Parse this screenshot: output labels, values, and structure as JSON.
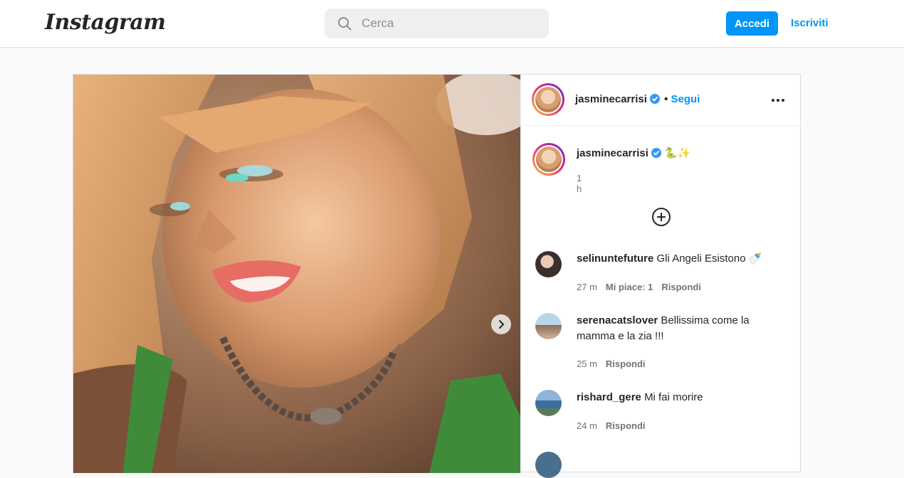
{
  "header": {
    "logo": "Instagram",
    "search_placeholder": "Cerca",
    "login_label": "Accedi",
    "signup_label": "Iscriviti"
  },
  "post": {
    "author": "jasminecarrisi",
    "follow_label": "Segui",
    "caption_emojis": "🐍✨",
    "posted_ago": "1 h",
    "comments": [
      {
        "user": "selinuntefuture",
        "text": "Gli Angeli Esistono 🍼",
        "time": "27 m",
        "likes": "Mi piace: 1",
        "reply": "Rispondi"
      },
      {
        "user": "serenacatslover",
        "text": "Bellissima come la mamma e la zia !!!",
        "time": "25 m",
        "likes": "",
        "reply": "Rispondi"
      },
      {
        "user": "rishard_gere",
        "text": "Mi fai morire",
        "time": "24 m",
        "likes": "",
        "reply": "Rispondi"
      }
    ]
  },
  "colors": {
    "accent": "#0095f6",
    "border": "#dbdbdb",
    "muted": "#737373"
  }
}
